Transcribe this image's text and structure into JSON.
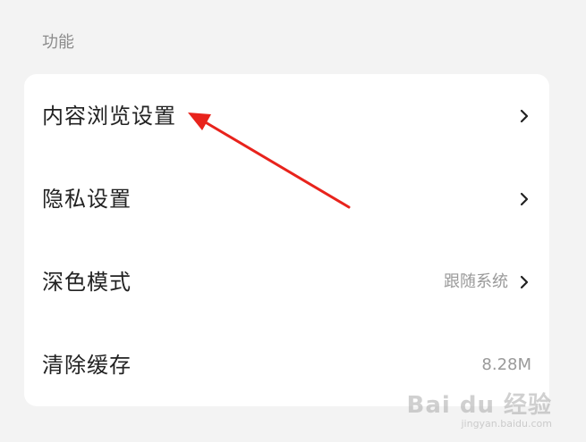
{
  "section": {
    "title": "功能"
  },
  "rows": [
    {
      "label": "内容浏览设置",
      "value": "",
      "chevron": true
    },
    {
      "label": "隐私设置",
      "value": "",
      "chevron": true
    },
    {
      "label": "深色模式",
      "value": "跟随系统",
      "chevron": true
    },
    {
      "label": "清除缓存",
      "value": "8.28M",
      "chevron": false
    }
  ],
  "annotation": {
    "color": "#e8231c"
  },
  "watermark": {
    "logo": "Bai du 经验",
    "url": "jingyan.baidu.com"
  }
}
